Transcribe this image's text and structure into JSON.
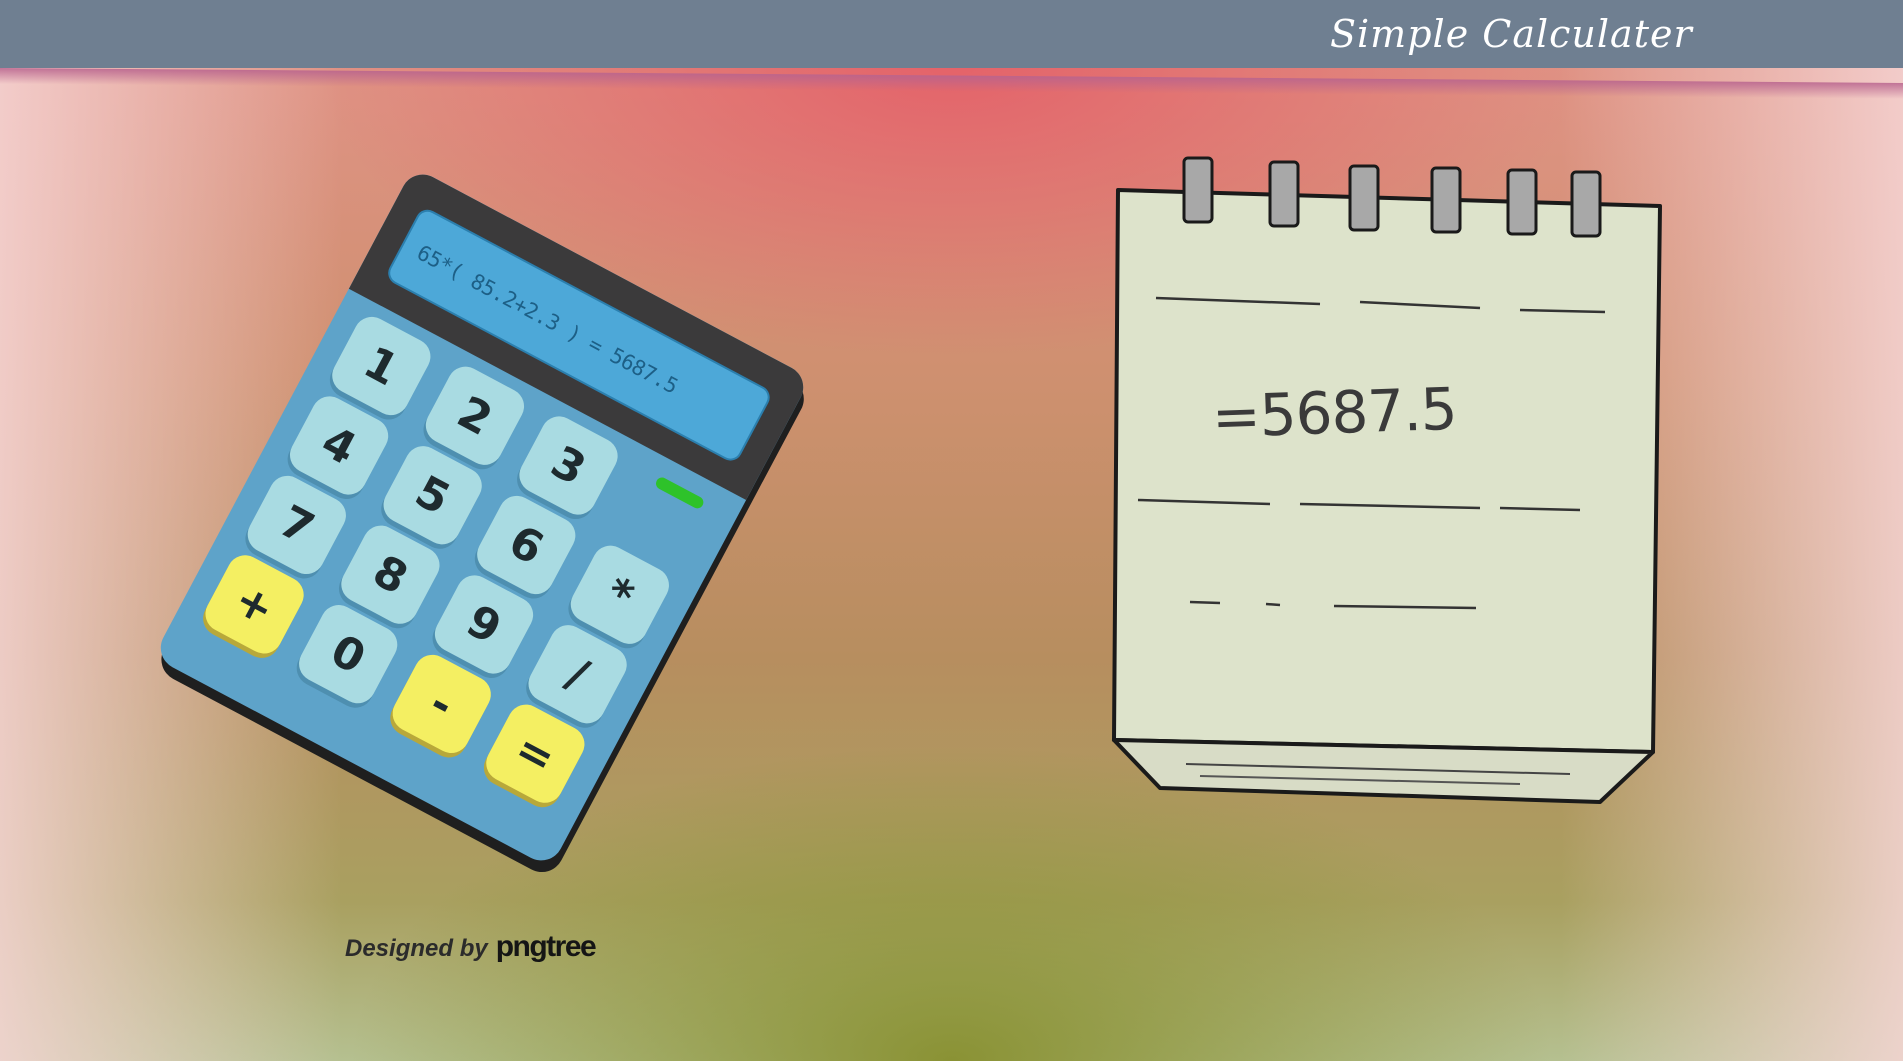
{
  "app": {
    "title": "Simple Calculater"
  },
  "calculator": {
    "display": "65*( 85.2+2.3 ) = 5687.5",
    "indicator_color": "#2ec22a",
    "keys": [
      "1",
      "2",
      "3",
      "4",
      "5",
      "6",
      "7",
      "8",
      "9",
      "*",
      "+",
      "0",
      "-",
      "/",
      "="
    ],
    "key_color": "#a9dbe2",
    "operator_key_color": "#f4ef62"
  },
  "notepad": {
    "result": "=5687.5"
  },
  "credit": {
    "label": "Designed by",
    "brand": "pngtree"
  }
}
